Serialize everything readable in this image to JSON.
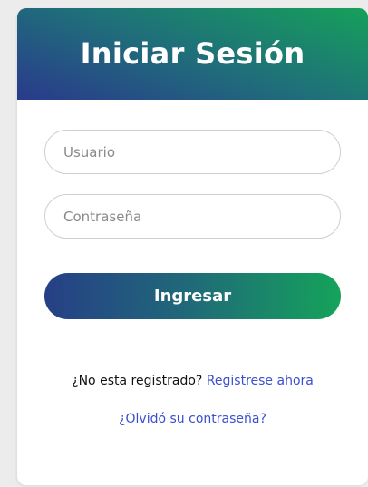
{
  "login": {
    "title": "Iniciar Sesión",
    "username_placeholder": "Usuario",
    "password_placeholder": "Contraseña",
    "submit_label": "Ingresar",
    "register_prompt": "¿No esta registrado?",
    "register_link": "Registrese ahora",
    "forgot_link": "¿Olvidó su contraseña?"
  },
  "colors": {
    "gradient_start": "#263f86",
    "gradient_end": "#15a35b",
    "link": "#3a4fcf"
  }
}
